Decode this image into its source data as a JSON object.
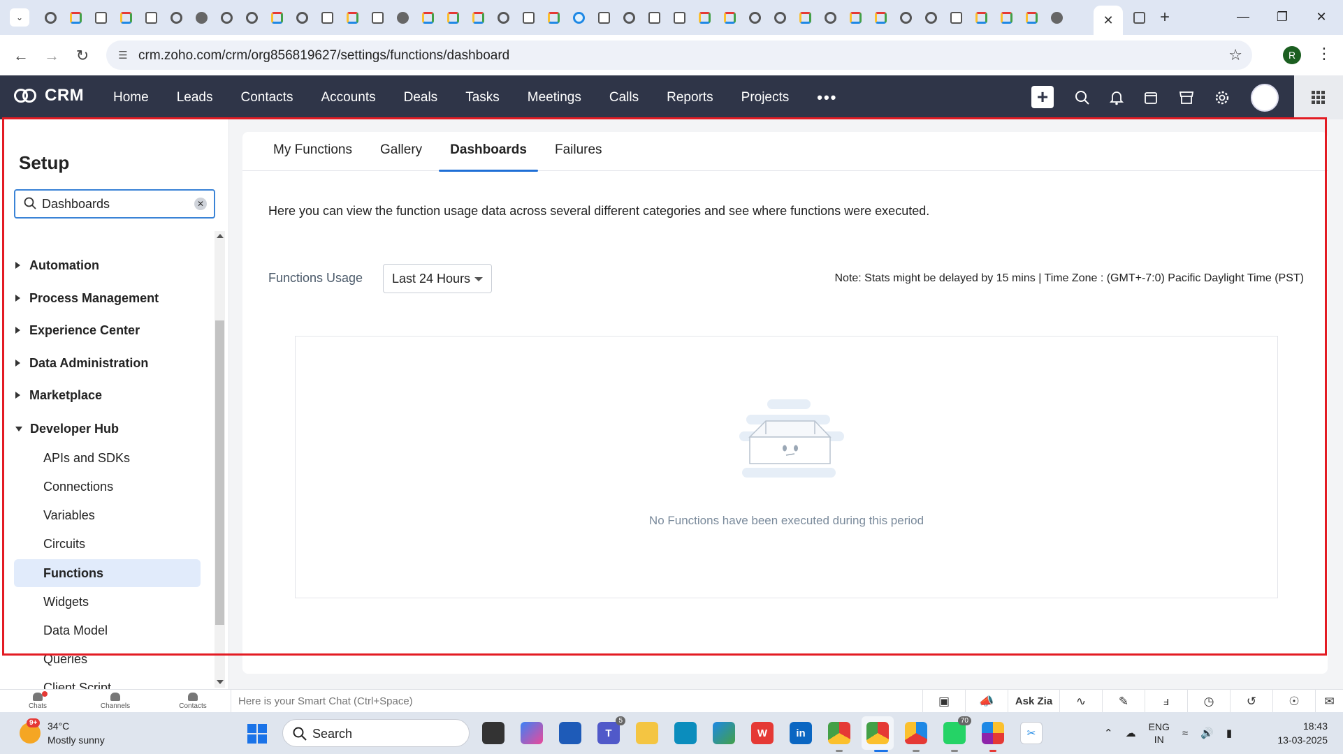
{
  "browser": {
    "url": "crm.zoho.com/crm/org856819627/settings/functions/dashboard",
    "profile_initial": "R",
    "tab_icons": [
      "chrome-icon",
      "zoho-icon",
      "doc-icon",
      "zoho-icon",
      "doc-icon",
      "chrome-icon",
      "globe-icon",
      "chrome-icon",
      "chrome-icon",
      "zoho-icon",
      "chrome-icon",
      "chart-doc-icon",
      "zoho-icon",
      "chart-doc-icon",
      "globe-icon",
      "zoho-icon",
      "zoho-icon",
      "zoho-icon",
      "chrome-icon",
      "doc-icon",
      "zoho-icon",
      "edge-icon",
      "doc-icon",
      "chrome-icon",
      "doc-icon",
      "chart-doc-icon",
      "zoho-icon",
      "zoho-icon",
      "chrome-icon",
      "chrome-icon",
      "zoho-icon",
      "chrome-icon",
      "zoho-icon",
      "zoho-icon",
      "chrome-icon",
      "chrome-icon",
      "chart-doc-icon",
      "zoho-icon",
      "zoho-icon",
      "zoho-icon",
      "globe-icon"
    ]
  },
  "crm": {
    "brand": "CRM",
    "nav": [
      "Home",
      "Leads",
      "Contacts",
      "Accounts",
      "Deals",
      "Tasks",
      "Meetings",
      "Calls",
      "Reports",
      "Projects"
    ],
    "more": "•••",
    "accent": "#2f3548"
  },
  "sidebar": {
    "title": "Setup",
    "search_value": "Dashboards",
    "groups": [
      {
        "label": "Automation",
        "expanded": false
      },
      {
        "label": "Process Management",
        "expanded": false
      },
      {
        "label": "Experience Center",
        "expanded": false
      },
      {
        "label": "Data Administration",
        "expanded": false
      },
      {
        "label": "Marketplace",
        "expanded": false
      },
      {
        "label": "Developer Hub",
        "expanded": true
      }
    ],
    "subitems": [
      "APIs and SDKs",
      "Connections",
      "Variables",
      "Circuits",
      "Functions",
      "Widgets",
      "Data Model",
      "Queries",
      "Client Script"
    ],
    "active_subitem": "Functions"
  },
  "main": {
    "tabs": [
      "My Functions",
      "Gallery",
      "Dashboards",
      "Failures"
    ],
    "active_tab": "Dashboards",
    "intro": "Here you can view the function usage data across several different categories and see where functions were executed.",
    "usage_label": "Functions Usage",
    "range_selected": "Last 24 Hours",
    "note": "Note: Stats might be delayed by 15 mins | Time Zone : (GMT+-7:0) Pacific Daylight Time (PST)",
    "empty_message": "No Functions have been executed during this period"
  },
  "chatbar": {
    "items": [
      "Chats",
      "Channels",
      "Contacts"
    ],
    "placeholder": "Here is your Smart Chat (Ctrl+Space)",
    "ask_zia": "Ask Zia"
  },
  "taskbar": {
    "weather_badge": "9+",
    "temperature": "34°C",
    "condition": "Mostly sunny",
    "search_label": "Search",
    "teams_count": "5",
    "whatsapp_count": "70",
    "lang_line1": "ENG",
    "lang_line2": "IN",
    "time": "18:43",
    "date": "13-03-2025"
  },
  "colors": {
    "highlight": "#e31b23",
    "active_tab_underline": "#1f6fd6",
    "active_menu_bg": "#e1ebfb"
  }
}
